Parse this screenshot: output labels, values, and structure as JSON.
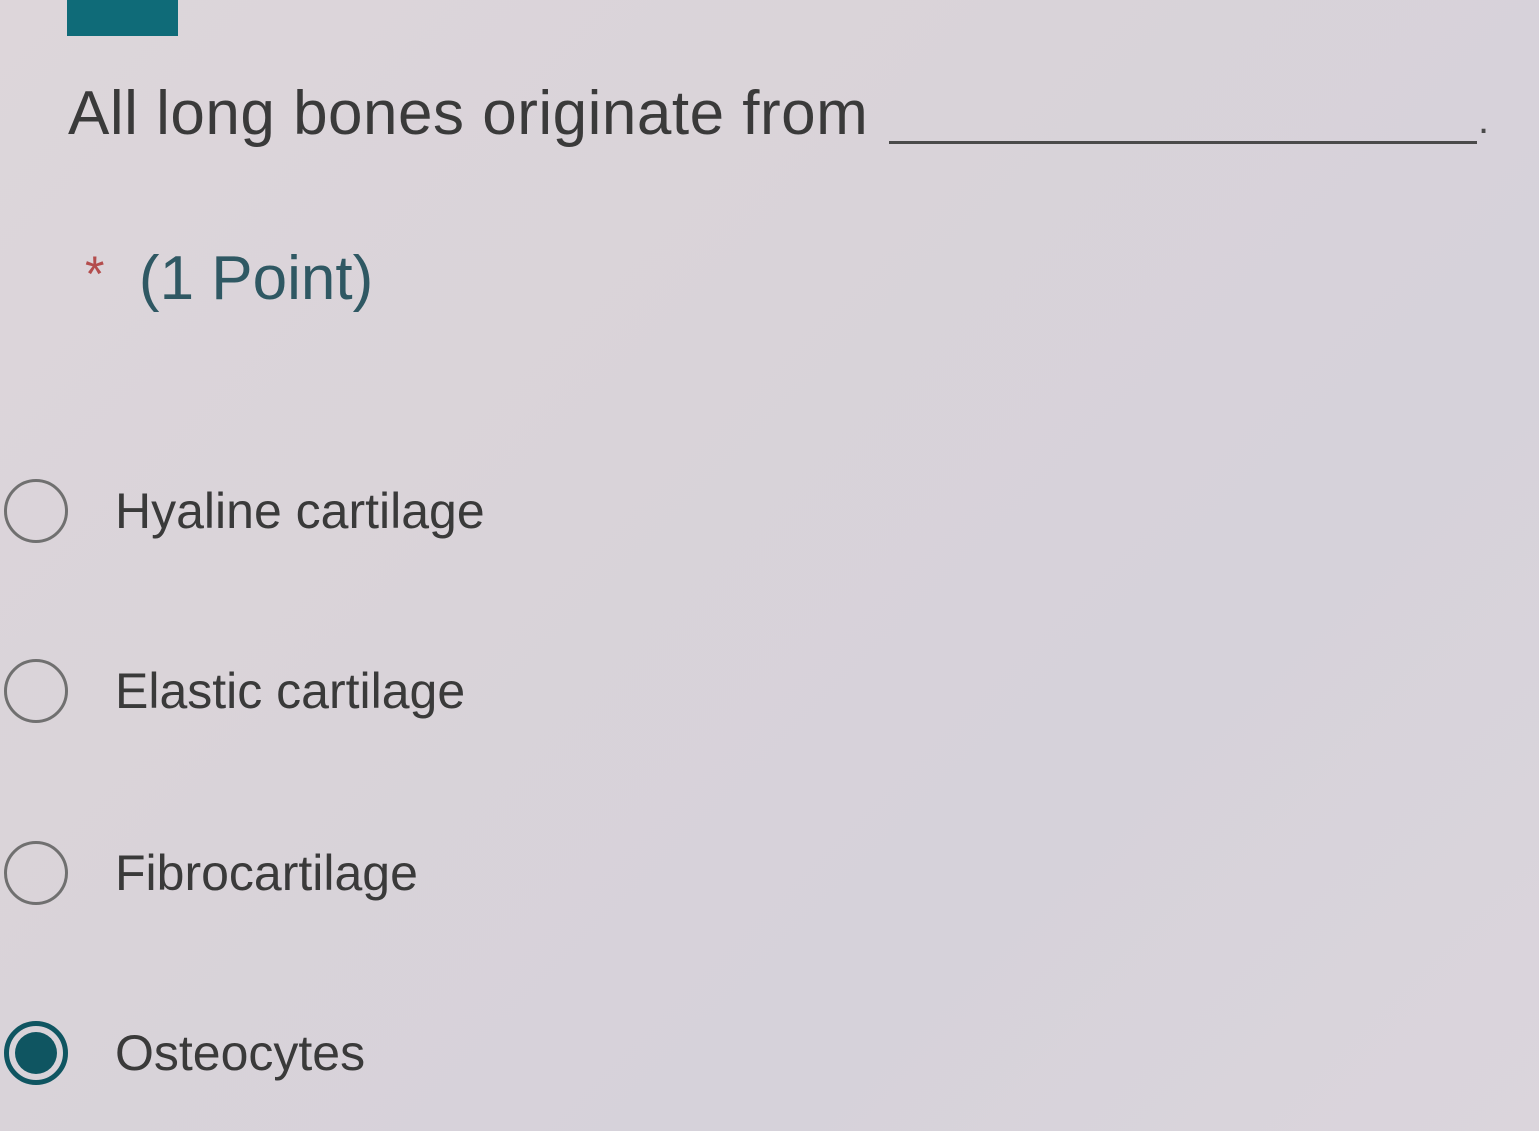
{
  "question": {
    "text": "All long bones originate from",
    "blank_end": "."
  },
  "required_marker": "*",
  "points_label": "(1 Point)",
  "options": [
    {
      "label": "Hyaline cartilage",
      "selected": false
    },
    {
      "label": "Elastic cartilage",
      "selected": false
    },
    {
      "label": "Fibrocartilage",
      "selected": false
    },
    {
      "label": "Osteocytes",
      "selected": true
    }
  ],
  "colors": {
    "accent": "#0f5561",
    "header_bar": "#0f6b78",
    "asterisk": "#b44d4d"
  }
}
